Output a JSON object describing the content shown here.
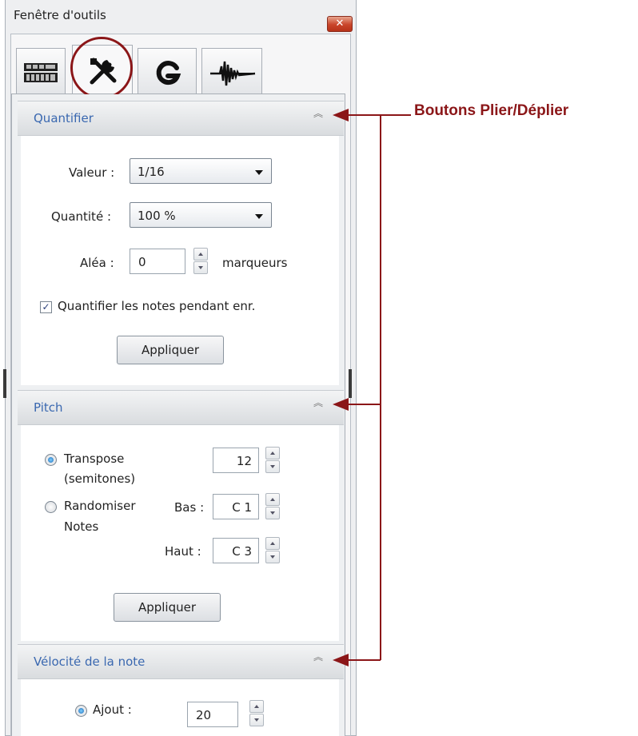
{
  "window": {
    "title": "Fenêtre d'outils",
    "close_glyph": "✕"
  },
  "tabs": [
    {
      "icon": "keyboard-grid-icon",
      "active": false
    },
    {
      "icon": "tools-icon",
      "active": true
    },
    {
      "icon": "g-logo-icon",
      "active": false
    },
    {
      "icon": "waveform-icon",
      "active": false
    }
  ],
  "quantifier": {
    "title": "Quantifier",
    "valeur_label": "Valeur :",
    "valeur_value": "1/16",
    "quantite_label": "Quantité :",
    "quantite_value": "100 %",
    "alea_label": "Aléa :",
    "alea_value": "0",
    "alea_unit": "marqueurs",
    "checkbox_label": "Quantifier les notes pendant enr.",
    "checkbox_checked": true,
    "apply_label": "Appliquer"
  },
  "pitch": {
    "title": "Pitch",
    "transpose_label_1": "Transpose",
    "transpose_label_2": "(semitones)",
    "transpose_value": "12",
    "randomize_label_1": "Randomiser",
    "randomize_label_2": "Notes",
    "bas_label": "Bas :",
    "bas_value": "C 1",
    "haut_label": "Haut :",
    "haut_value": "C 3",
    "apply_label": "Appliquer"
  },
  "velocity": {
    "title": "Vélocité de la note",
    "ajout_label": "Ajout :",
    "ajout_value": "20"
  },
  "collapse_glyph": "︽",
  "annotation": {
    "text": "Boutons Plier/Déplier",
    "color": "#8b1618"
  }
}
